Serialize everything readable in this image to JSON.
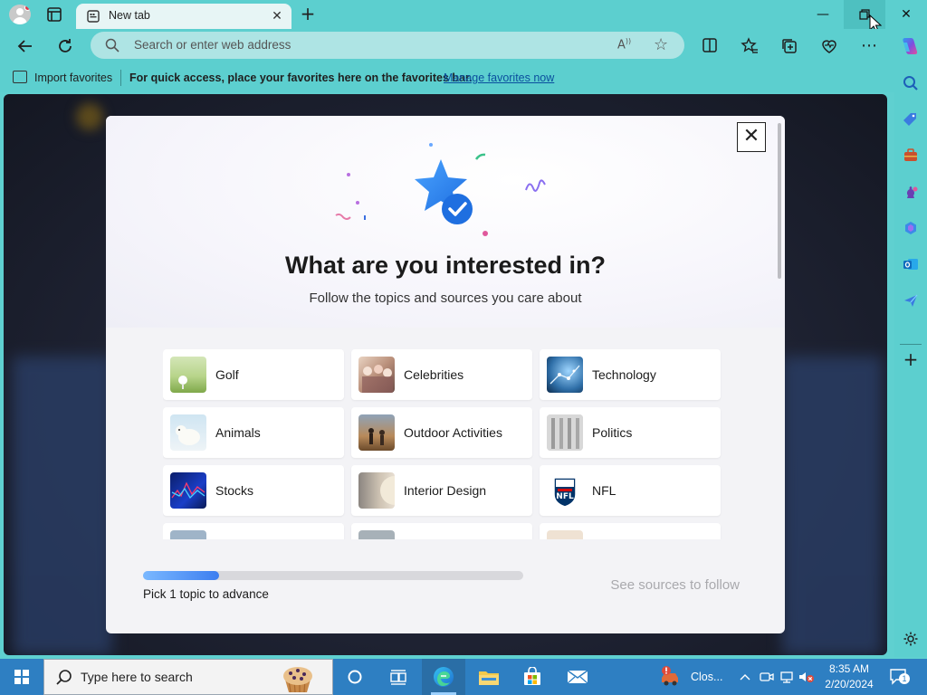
{
  "browser": {
    "tab": {
      "title": "New tab"
    },
    "address_bar": {
      "placeholder": "Search or enter web address"
    },
    "favorites_bar": {
      "import_label": "Import favorites",
      "hint": "For quick access, place your favorites here on the favorites bar.",
      "manage_link": "Manage favorites now"
    }
  },
  "dialog": {
    "title": "What are you interested in?",
    "subtitle": "Follow the topics and sources you care about",
    "topics": [
      {
        "label": "Golf"
      },
      {
        "label": "Celebrities"
      },
      {
        "label": "Technology"
      },
      {
        "label": "Animals"
      },
      {
        "label": "Outdoor Activities"
      },
      {
        "label": "Politics"
      },
      {
        "label": "Stocks"
      },
      {
        "label": "Interior Design"
      },
      {
        "label": "NFL"
      }
    ],
    "progress": {
      "label": "Pick 1 topic to advance",
      "value_percent": 20
    },
    "next_button": "See sources to follow"
  },
  "taskbar": {
    "search_placeholder": "Type here to search",
    "notification_text": "Clos...",
    "time": "8:35 AM",
    "date": "2/20/2024",
    "notification_count": "1"
  },
  "colors": {
    "browser_chrome": "#5ccfcf",
    "accent_blue": "#3d7ef0",
    "taskbar": "#2e7fc2"
  }
}
